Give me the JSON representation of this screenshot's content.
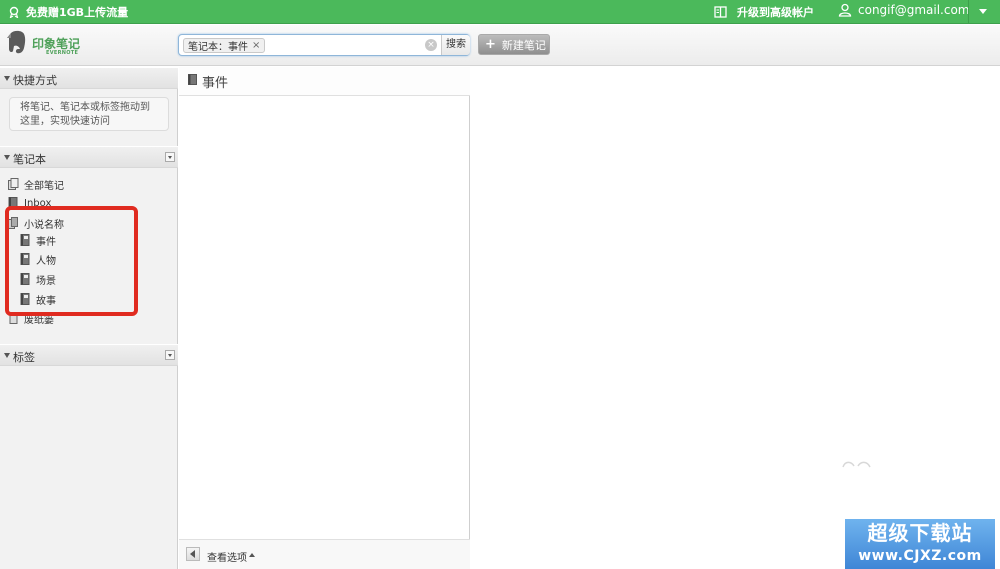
{
  "topbar": {
    "promo_text": "免费赠1GB上传流量",
    "upgrade_text": "升级到高级帐户",
    "account_email": "congif@gmail.com"
  },
  "header": {
    "logo_cn": "印象笔记",
    "logo_en": "EVERNOTE",
    "search_token": "笔记本：事件",
    "search_button": "搜索",
    "new_note_button": "新建笔记"
  },
  "sidebar": {
    "shortcuts_title": "快捷方式",
    "shortcuts_hint": "将笔记、笔记本或标签拖动到这里，实现快速访问",
    "notebooks_title": "笔记本",
    "all_notes": "全部笔记",
    "inbox": "Inbox",
    "stack_name": "小说名称",
    "notebooks": [
      "事件",
      "人物",
      "场景",
      "故事"
    ],
    "trash": "废纸篓",
    "tags_title": "标签"
  },
  "notelist": {
    "title": "事件",
    "view_options": "查看选项"
  },
  "watermark": {
    "line1": "超级下载站",
    "line2": "www.CJXZ.com"
  },
  "colors": {
    "topbar_green": "#4bb95b",
    "highlight_red": "#e02b20"
  }
}
